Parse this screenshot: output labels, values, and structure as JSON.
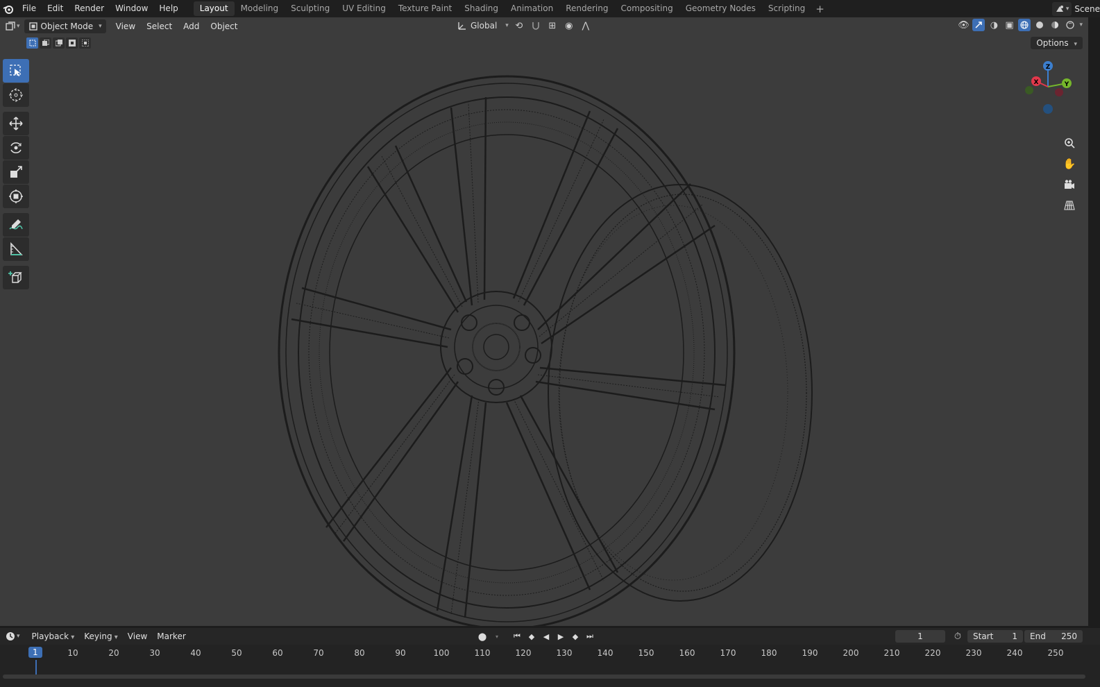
{
  "topbar": {
    "menus": [
      "File",
      "Edit",
      "Render",
      "Window",
      "Help"
    ],
    "workspace_tabs": [
      "Layout",
      "Modeling",
      "Sculpting",
      "UV Editing",
      "Texture Paint",
      "Shading",
      "Animation",
      "Rendering",
      "Compositing",
      "Geometry Nodes",
      "Scripting"
    ],
    "active_tab": "Layout",
    "add_tab": "+",
    "scene_label": "Scene"
  },
  "viewport": {
    "mode": "Object Mode",
    "menus": [
      "View",
      "Select",
      "Add",
      "Object"
    ],
    "orientation": "Global",
    "options_label": "Options",
    "gizmo_axes": {
      "x": "X",
      "y": "Y",
      "z": "Z"
    },
    "colors": {
      "background": "#3c3c3c",
      "accent": "#3d6fb5",
      "x_axis": "#e2384b",
      "y_axis": "#76b62b",
      "z_axis": "#3c7fcf",
      "wire": "#1c1c1c"
    }
  },
  "toolbar": {
    "tools": [
      "select-box-icon",
      "cursor-icon",
      "move-icon",
      "rotate-icon",
      "scale-icon",
      "transform-icon",
      "annotate-icon",
      "measure-icon",
      "add-cube-icon"
    ]
  },
  "timeline": {
    "menus": [
      "Playback",
      "Keying",
      "View",
      "Marker"
    ],
    "current_frame": "1",
    "start_label": "Start",
    "start_value": "1",
    "end_label": "End",
    "end_value": "250",
    "ruler_labels": [
      "10",
      "20",
      "30",
      "40",
      "50",
      "60",
      "70",
      "80",
      "90",
      "100",
      "110",
      "120",
      "130",
      "140",
      "150",
      "160",
      "170",
      "180",
      "190",
      "200",
      "210",
      "220",
      "230",
      "240",
      "250"
    ],
    "playhead_label": "1"
  }
}
